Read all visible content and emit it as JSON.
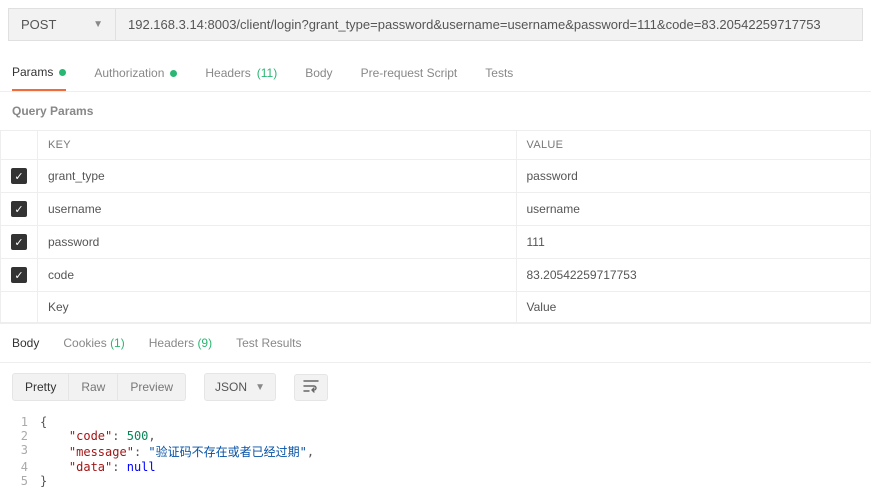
{
  "urlbar": {
    "method": "POST",
    "url": "192.168.3.14:8003/client/login?grant_type=password&username=username&password=111&code=83.20542259717753"
  },
  "reqTabs": {
    "params": "Params",
    "authorization": "Authorization",
    "headers": "Headers",
    "headersCount": "(11)",
    "body": "Body",
    "prerequest": "Pre-request Script",
    "tests": "Tests"
  },
  "queryParams": {
    "title": "Query Params",
    "keyHeader": "KEY",
    "valueHeader": "VALUE",
    "rows": [
      {
        "key": "grant_type",
        "value": "password"
      },
      {
        "key": "username",
        "value": "username"
      },
      {
        "key": "password",
        "value": "111"
      },
      {
        "key": "code",
        "value": "83.20542259717753"
      }
    ],
    "keyPlaceholder": "Key",
    "valuePlaceholder": "Value"
  },
  "respTabs": {
    "body": "Body",
    "cookies": "Cookies",
    "cookiesCount": "(1)",
    "headers": "Headers",
    "headersCount": "(9)",
    "testResults": "Test Results"
  },
  "respToolbar": {
    "pretty": "Pretty",
    "raw": "Raw",
    "preview": "Preview",
    "format": "JSON"
  },
  "respBody": {
    "line1": "{",
    "line2_key": "\"code\"",
    "line2_val": "500",
    "line3_key": "\"message\"",
    "line3_val": "\"验证码不存在或者已经过期\"",
    "line4_key": "\"data\"",
    "line4_val": "null",
    "line5": "}"
  },
  "chart_data": null
}
